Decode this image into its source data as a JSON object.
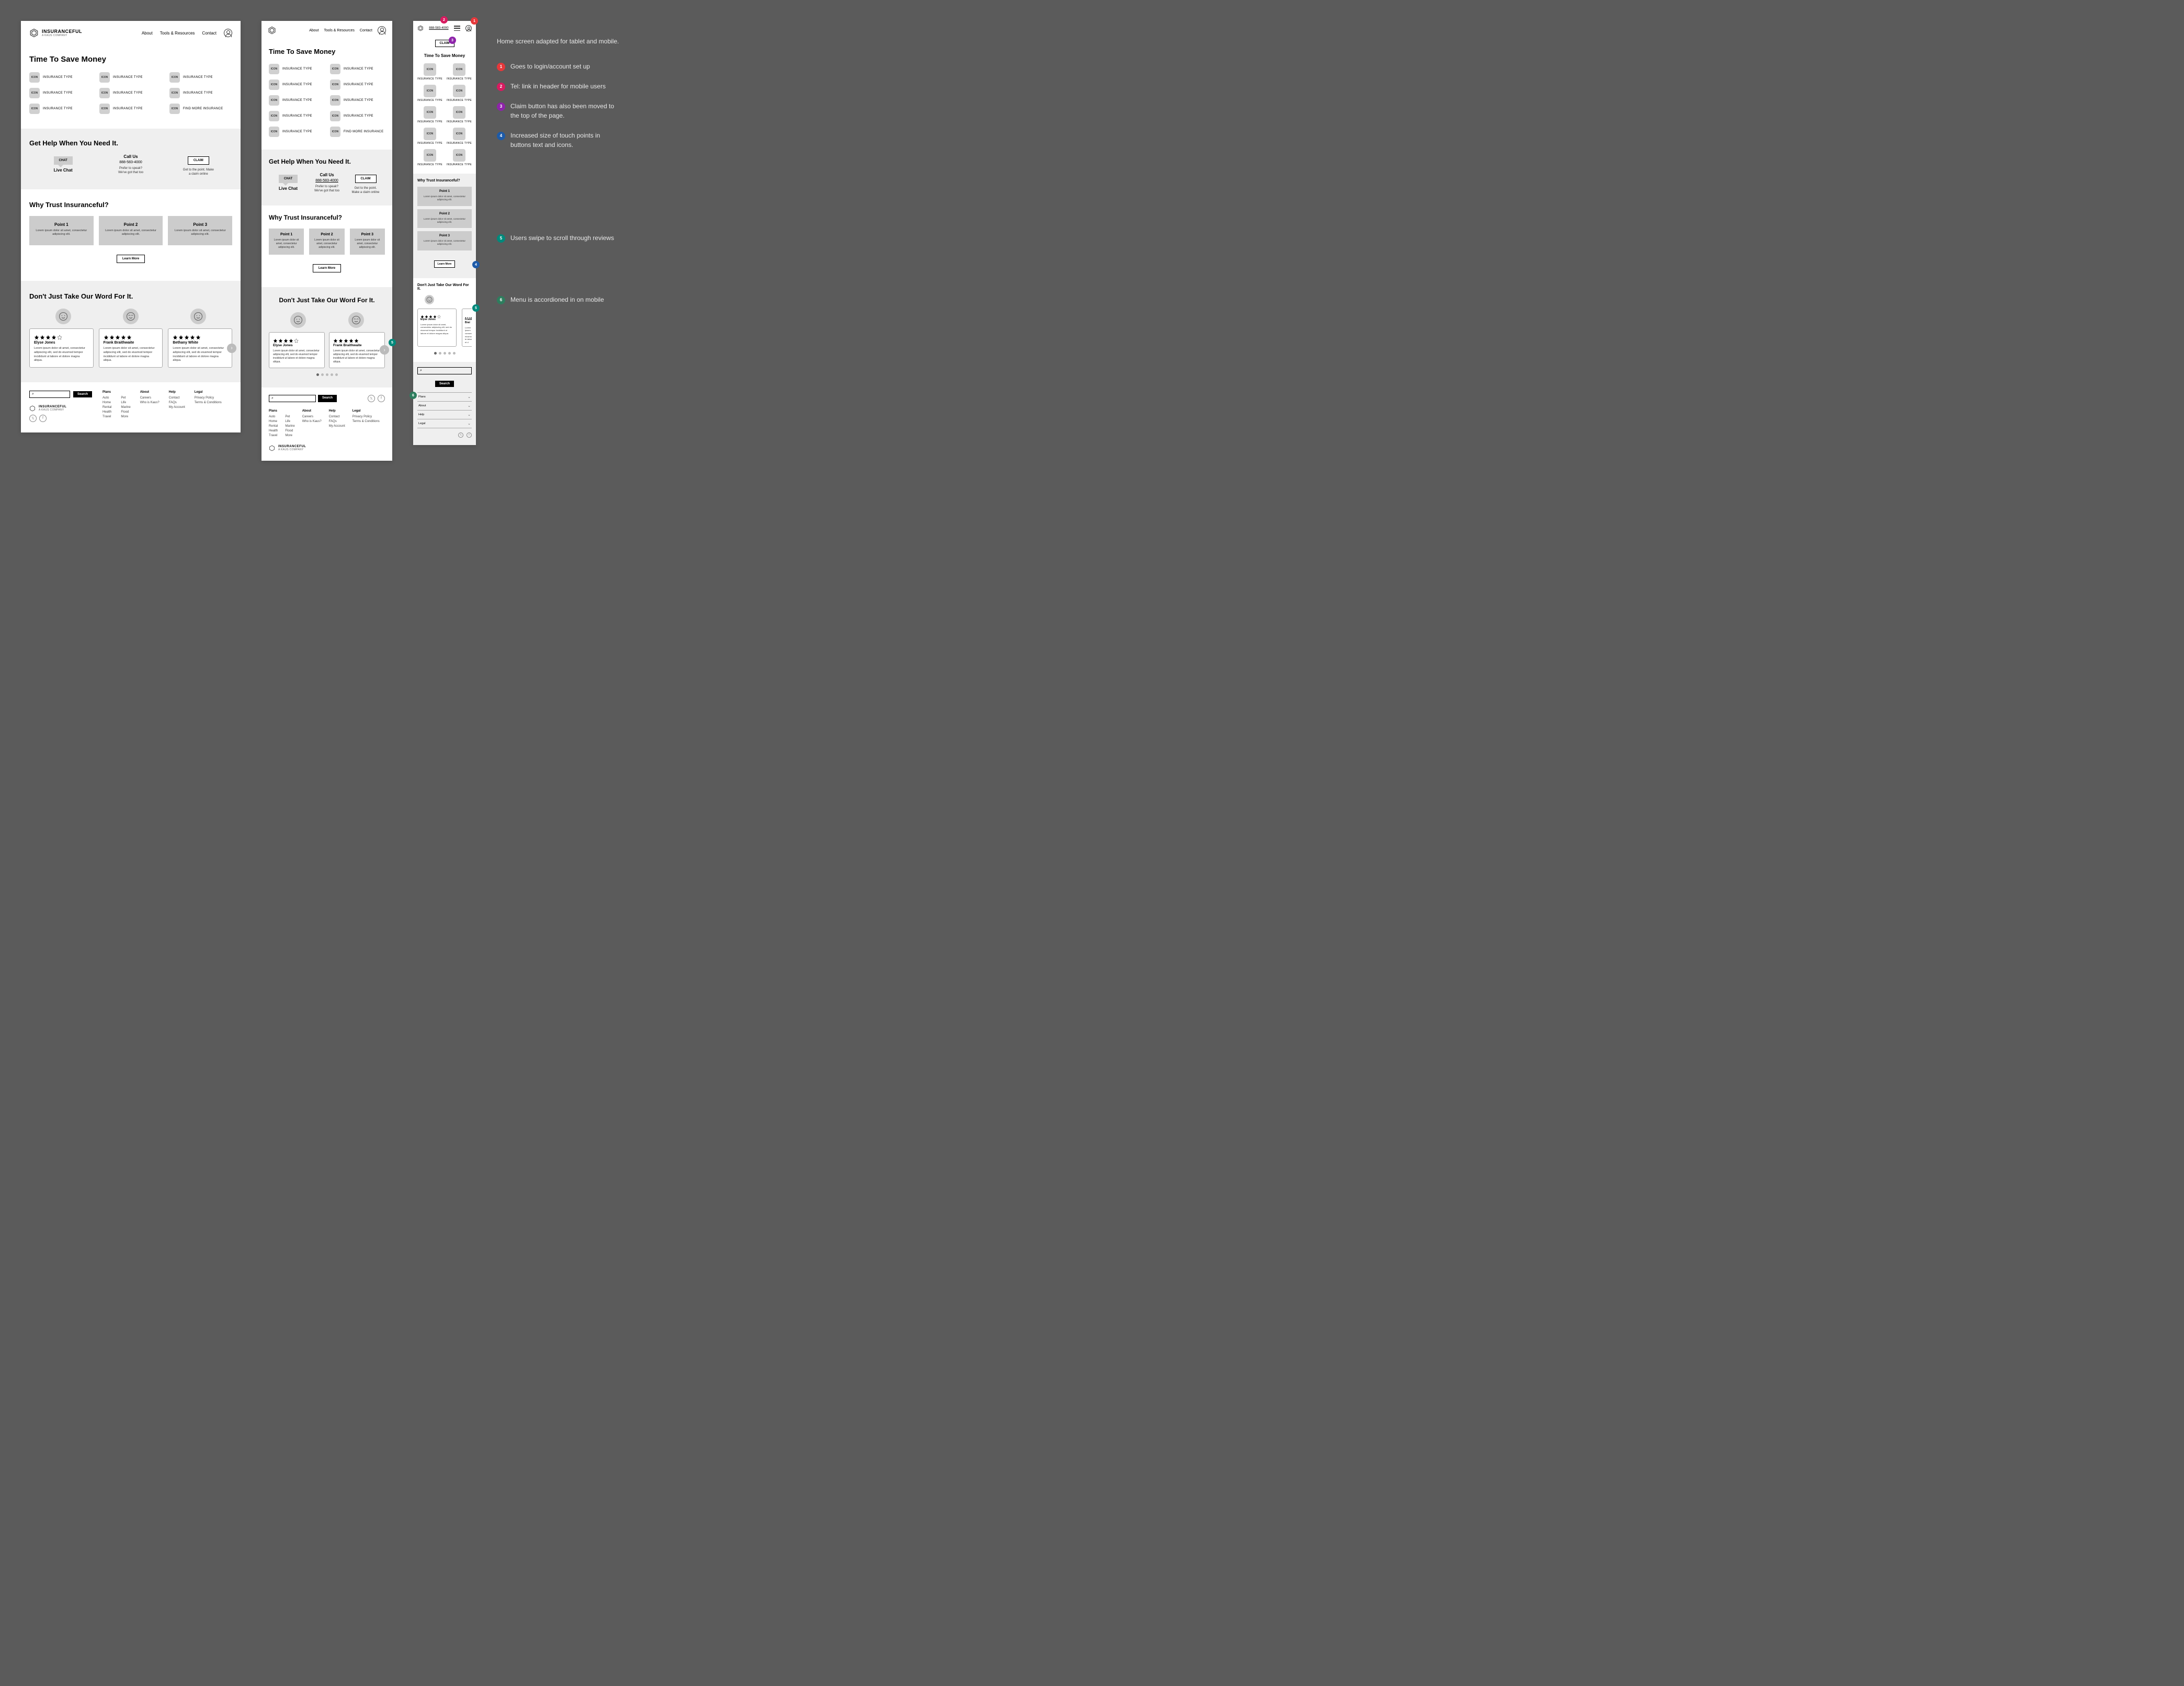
{
  "brand": {
    "name": "INSURANCEFUL",
    "sub": "A KAUS COMPANY"
  },
  "nav": {
    "about": "About",
    "tools": "Tools & Resources",
    "contact": "Contact"
  },
  "mobile": {
    "tel": "888-583-4000",
    "claim": "CLAIM"
  },
  "hero": {
    "title": "Time To Save Money",
    "icon_label": "ICON",
    "type_label": "INSURANCE TYPE",
    "more_label": "FIND MORE INSURANCE"
  },
  "help": {
    "title": "Get Help When You Need It.",
    "chat_bubble": "CHAT",
    "chat_label": "Live Chat",
    "call_title": "Call Us",
    "call_phone": "888-583-4000",
    "call_sub1": "Prefer to speak?",
    "call_sub2": "We've got that too",
    "claim_btn": "CLAIM",
    "claim_sub1": "Get to the point. Make",
    "claim_sub2": "a claim online",
    "claim_sub1_t": "Get to the point.",
    "claim_sub2_t": "Make a claim online"
  },
  "trust": {
    "title": "Why Trust Insuranceful?",
    "points": [
      {
        "title": "Point 1",
        "body": "Lorem ipsum dolor sit amet, consectetur adipiscing elit."
      },
      {
        "title": "Point 2",
        "body": "Lorem ipsum dolor sit amet, consectetur adipiscing elit."
      },
      {
        "title": "Point 3",
        "body": "Lorem ipsum dolor sit amet, consectetur adipiscing elit."
      }
    ],
    "learn": "Learn More"
  },
  "reviews": {
    "title": "Don't Just Take Our Word For It.",
    "cards": [
      {
        "name": "Elyse Jones",
        "stars": 4,
        "body": "Lorem ipsum dolor sit amet, consectetur adipiscing elit, sed do eiusmod tempor incididunt ut labore et dolore magna aliqua."
      },
      {
        "name": "Frank Braithwaite",
        "stars": 5,
        "body": "Lorem ipsum dolor sit amet, consectetur adipiscing elit, sed do eiusmod tempor incididunt ut labore et dolore magna aliqua."
      },
      {
        "name": "Bethany White",
        "stars": 5,
        "body": "Lorem ipsum dolor sit amet, consectetur adipiscing elit, sed do eiusmod tempor incididunt ut labore et dolore magna aliqua."
      }
    ],
    "mobile_peek_name": "Frank Brai",
    "mobile_peek_body": "Lorem ipsum consectetur eiusmod te labore et d"
  },
  "footer": {
    "search_icon": "⌕",
    "search_btn": "Search",
    "cols": {
      "plans": {
        "h": "Plans",
        "items1": [
          "Auto",
          "Home",
          "Rental",
          "Health",
          "Travel"
        ],
        "items2": [
          "Pet",
          "Life",
          "Marine",
          "Flood",
          "More"
        ]
      },
      "about": {
        "h": "About",
        "items": [
          "Careers",
          "Who is Kaus?"
        ]
      },
      "help": {
        "h": "Help",
        "items": [
          "Contact",
          "FAQs",
          "My Account"
        ]
      },
      "legal": {
        "h": "Legal",
        "items": [
          "Privacy Policy",
          "Terms & Conditions"
        ]
      }
    },
    "accordion": [
      "Plans",
      "About",
      "Help",
      "Legal"
    ]
  },
  "annotations": {
    "intro": "Home screen adapted for tablet and mobile.",
    "a1": "Goes to login/account set up",
    "a2": "Tel: link in header for mobile users",
    "a3": "Claim button has also been moved to the top of the page.",
    "a4": "Increased size of touch points in buttons text and icons.",
    "a5": "Users swipe to scroll through reviews",
    "a6": "Menu is accordioned in on mobile"
  }
}
